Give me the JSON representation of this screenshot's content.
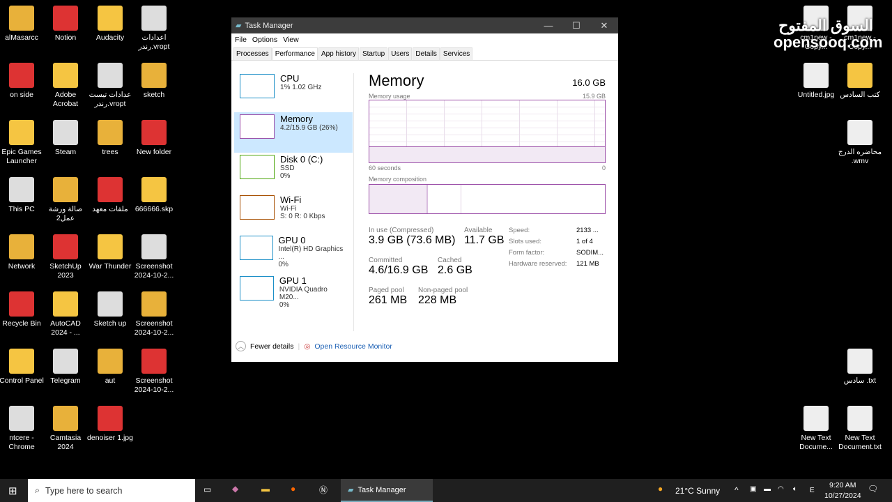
{
  "desktop": {
    "left_columns": [
      [
        "alMasarcc",
        "on side",
        "Epic Games Launcher",
        "This PC",
        "Network",
        "Recycle Bin",
        "Control Panel",
        "ntcere - Chrome"
      ],
      [
        "Notion",
        "Adobe Acrobat",
        "Steam",
        "صالة ورشة عمل2",
        "SketchUp 2023",
        "AutoCAD 2024 - ...",
        "Telegram",
        "Camtasia 2024"
      ],
      [
        "Audacity",
        "عدادات تيست رندر.vropt",
        "trees",
        "ملفات معهد",
        "War Thunder",
        "Sketch up",
        "aut",
        "denoiser 1.jpg"
      ],
      [
        "اعدادات رندر.vropt",
        "sketch",
        "New folder",
        "666666.skp",
        "Screenshot 2024-10-2...",
        "Screenshot 2024-10-2...",
        "Screenshot 2024-10-2..."
      ]
    ],
    "right_icons": [
      "cm1new - Copy...",
      "cm1new - Copy...",
      "Untitled.jpg",
      "كتب السادس",
      "محاضره الدرج .wmv",
      "سادس .txt",
      "New Text Docume...",
      "New Text Document.txt"
    ],
    "watermark": "السوق المفتوح opensooq.com"
  },
  "window": {
    "title": "Task Manager",
    "menu": [
      "File",
      "Options",
      "View"
    ],
    "tabs": [
      "Processes",
      "Performance",
      "App history",
      "Startup",
      "Users",
      "Details",
      "Services"
    ],
    "active_tab": "Performance",
    "devices": [
      {
        "name": "CPU",
        "l1": "1% 1.02 GHz",
        "l2": "",
        "color": "#1b8fc7"
      },
      {
        "name": "Memory",
        "l1": "4.2/15.9 GB (26%)",
        "l2": "",
        "color": "#9b4ea8"
      },
      {
        "name": "Disk 0 (C:)",
        "l1": "SSD",
        "l2": "0%",
        "color": "#4da60c"
      },
      {
        "name": "Wi-Fi",
        "l1": "Wi-Fi",
        "l2": "S: 0 R: 0 Kbps",
        "color": "#a74f01"
      },
      {
        "name": "GPU 0",
        "l1": "Intel(R) HD Graphics ...",
        "l2": "0%",
        "color": "#1b8fc7"
      },
      {
        "name": "GPU 1",
        "l1": "NVIDIA Quadro M20...",
        "l2": "0%",
        "color": "#1b8fc7"
      }
    ],
    "memory": {
      "title": "Memory",
      "total": "16.0 GB",
      "usage_label": "Memory usage",
      "usage_max": "15.9 GB",
      "x_left": "60 seconds",
      "x_right": "0",
      "composition_label": "Memory composition",
      "usage_fraction": 0.26,
      "stats": [
        {
          "label": "In use (Compressed)",
          "value": "3.9 GB (73.6 MB)"
        },
        {
          "label": "Available",
          "value": "11.7 GB"
        },
        {
          "label": "Committed",
          "value": "4.6/16.9 GB"
        },
        {
          "label": "Cached",
          "value": "2.6 GB"
        },
        {
          "label": "Paged pool",
          "value": "261 MB"
        },
        {
          "label": "Non-paged pool",
          "value": "228 MB"
        }
      ],
      "props": [
        {
          "k": "Speed:",
          "v": "2133 ..."
        },
        {
          "k": "Slots used:",
          "v": "1 of 4"
        },
        {
          "k": "Form factor:",
          "v": "SODIM..."
        },
        {
          "k": "Hardware reserved:",
          "v": "121 MB"
        }
      ]
    },
    "footer": {
      "fewer": "Fewer details",
      "monitor": "Open Resource Monitor"
    }
  },
  "taskbar": {
    "search_placeholder": "Type here to search",
    "app": "Task Manager",
    "weather": "21°C  Sunny",
    "lang": "E",
    "time": "9:20 AM",
    "date": "10/27/2024"
  }
}
